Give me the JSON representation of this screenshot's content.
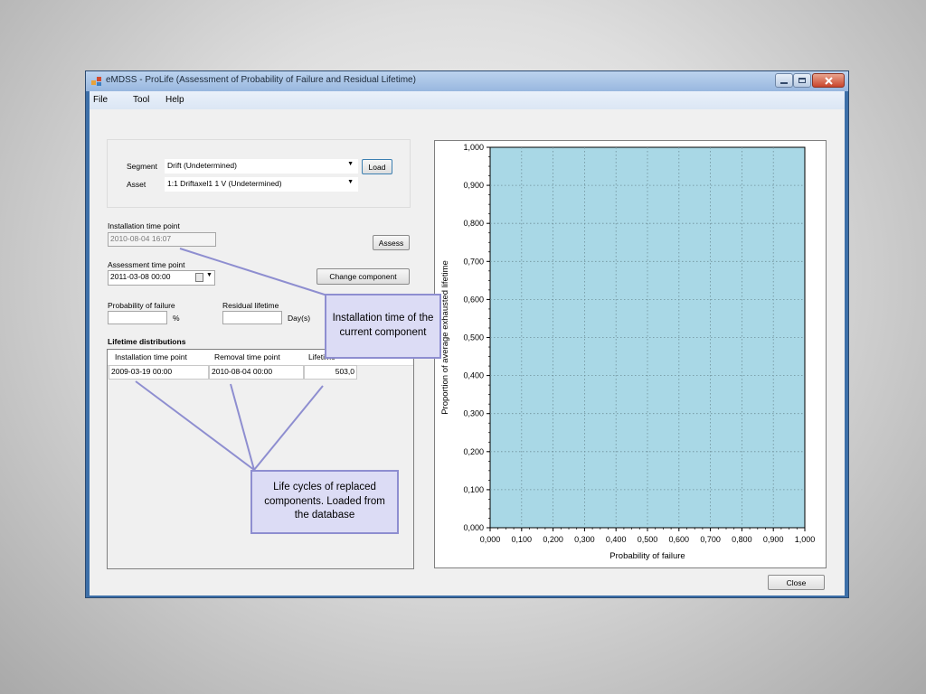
{
  "window": {
    "title": "eMDSS - ProLife (Assessment of Probability of Failure and Residual Lifetime)",
    "controls": [
      "minimize",
      "maximize",
      "close"
    ]
  },
  "menu": [
    "File",
    "Tool",
    "Help"
  ],
  "form": {
    "segment_label": "Segment",
    "segment_value": "Drift (Undetermined)",
    "asset_label": "Asset",
    "asset_value": "1:1    Driftaxel1 1 V (Undetermined)",
    "load_button": "Load",
    "installation_label": "Installation time point",
    "installation_value": "2010-08-04 16:07",
    "assess_button": "Assess",
    "assessment_label": "Assessment time point",
    "assessment_value": "2011-03-08 00:00",
    "change_button": "Change component",
    "pof_label": "Probability of failure",
    "pof_unit": "%",
    "residual_label": "Residual lifetime",
    "residual_unit": "Day(s)",
    "lifetime_heading": "Lifetime distributions",
    "table": {
      "headers": [
        "Installation time point",
        "Removal time point",
        "Lifetime"
      ],
      "rows": [
        [
          "2009-03-19 00:00",
          "2010-08-04 00:00",
          "503,0"
        ]
      ]
    },
    "close_button": "Close"
  },
  "callouts": {
    "installation": "Installation time of the current component",
    "lifecycles": "Life cycles of replaced components. Loaded from the database"
  },
  "colors": {
    "plot_background": "#a9d8e6",
    "callout_fill": "#dcdcf5",
    "callout_border": "#8e8ed0",
    "window_frame": "#3d6fa8"
  },
  "chart_data": {
    "type": "scatter",
    "title": "",
    "xlabel": "Probability of failure",
    "ylabel": "Proportion of average exhausted lifetime",
    "xlim": [
      0,
      1
    ],
    "ylim": [
      0,
      1
    ],
    "x_ticks": [
      "0,000",
      "0,100",
      "0,200",
      "0,300",
      "0,400",
      "0,500",
      "0,600",
      "0,700",
      "0,800",
      "0,900",
      "1,000"
    ],
    "y_ticks": [
      "0,000",
      "0,100",
      "0,200",
      "0,300",
      "0,400",
      "0,500",
      "0,600",
      "0,700",
      "0,800",
      "0,900",
      "1,000"
    ],
    "grid": true,
    "series": []
  }
}
